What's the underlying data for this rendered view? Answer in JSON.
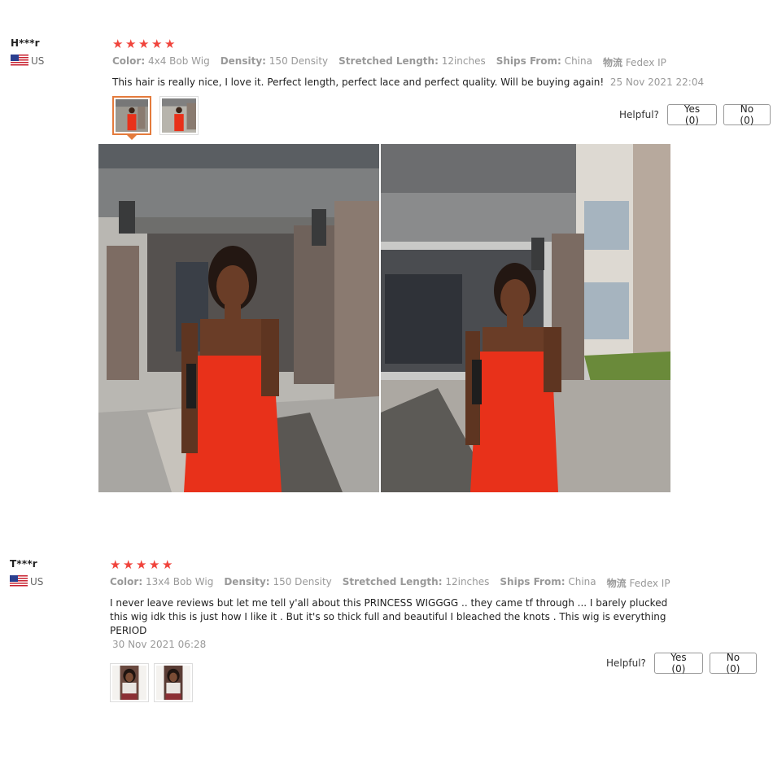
{
  "reviews": [
    {
      "user": {
        "name": "H***r",
        "country": "US"
      },
      "rating": 5,
      "attributes": [
        {
          "key": "Color:",
          "value": "4x4 Bob Wig"
        },
        {
          "key": "Density:",
          "value": "150 Density"
        },
        {
          "key": "Stretched Length:",
          "value": "12inches"
        },
        {
          "key": "Ships From:",
          "value": "China"
        },
        {
          "key": "物流",
          "value": "Fedex IP"
        }
      ],
      "text": "This hair is really nice, I love it. Perfect length, perfect lace and perfect quality. Will be buying again!",
      "date": "25 Nov 2021 22:04",
      "helpful_label": "Helpful?",
      "yes_label": "Yes (0)",
      "no_label": "No (0)",
      "thumbnails": 2,
      "selected_thumbnail": 1
    },
    {
      "user": {
        "name": "T***r",
        "country": "US"
      },
      "rating": 5,
      "attributes": [
        {
          "key": "Color:",
          "value": "13x4 Bob Wig"
        },
        {
          "key": "Density:",
          "value": "150 Density"
        },
        {
          "key": "Stretched Length:",
          "value": "12inches"
        },
        {
          "key": "Ships From:",
          "value": "China"
        },
        {
          "key": "物流",
          "value": "Fedex IP"
        }
      ],
      "text": "I never leave reviews but let me tell y'all about this PRINCESS WIGGGG .. they came tf through ... I barely plucked this wig idk this is just how I like it . But it's so thick full and beautiful I bleached the knots . This wig is everything PERIOD",
      "date": "30 Nov 2021 06:28",
      "helpful_label": "Helpful?",
      "yes_label": "Yes (0)",
      "no_label": "No (0)",
      "thumbnails": 2
    }
  ],
  "colors": {
    "star": "#f0443c",
    "selected_thumb_border": "#e47b3c",
    "dress_red": "#e8311a"
  },
  "icons": [
    "us-flag-icon",
    "star-icon"
  ]
}
